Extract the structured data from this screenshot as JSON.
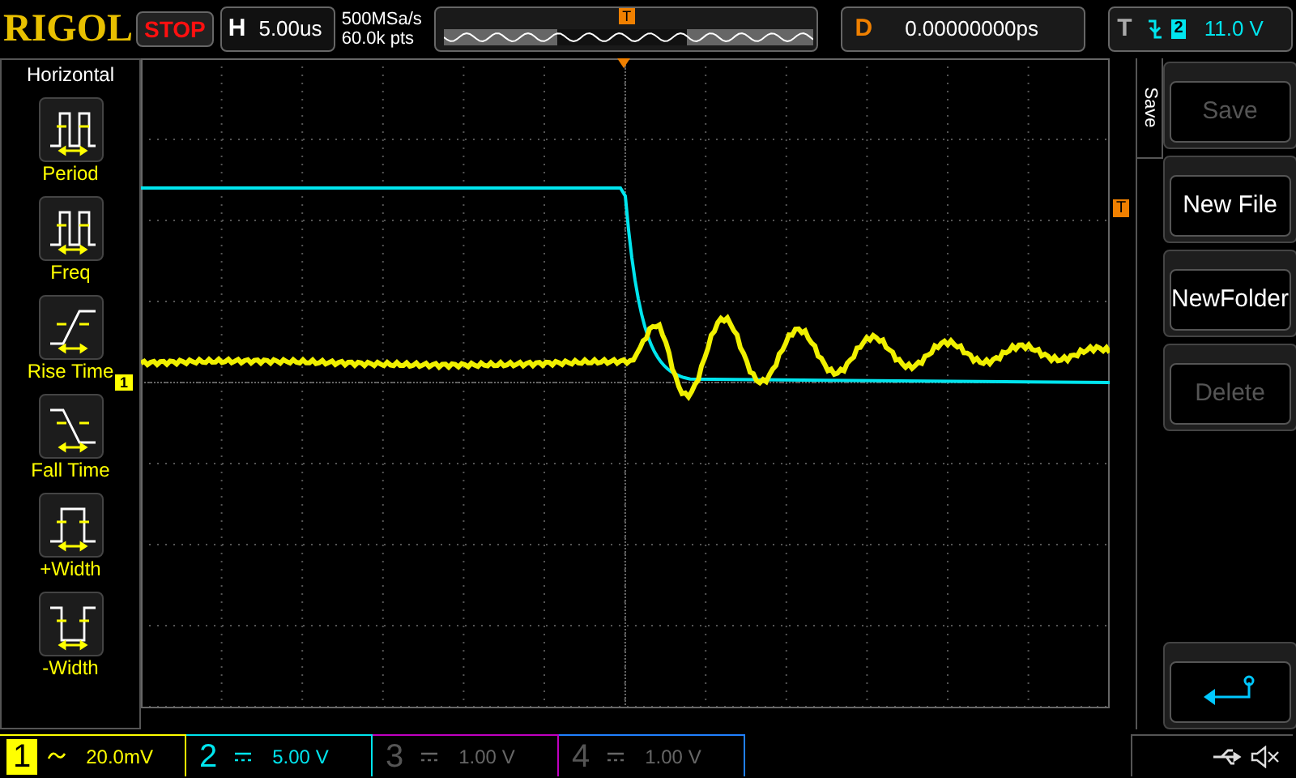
{
  "brand": "RIGOL",
  "run_state": "STOP",
  "horizontal": {
    "label": "H",
    "timebase": "5.00us"
  },
  "acquisition": {
    "sample_rate": "500MSa/s",
    "memory_depth": "60.0k pts"
  },
  "memory_bar": {
    "trigger_marker": "T"
  },
  "delay": {
    "label": "D",
    "value": "0.00000000ps"
  },
  "trigger": {
    "label": "T",
    "source": "2",
    "level": "11.0 V"
  },
  "left_menu": {
    "title": "Horizontal",
    "items": [
      {
        "label": "Period",
        "kind": "period"
      },
      {
        "label": "Freq",
        "kind": "freq"
      },
      {
        "label": "Rise Time",
        "kind": "rise"
      },
      {
        "label": "Fall Time",
        "kind": "fall"
      },
      {
        "label": "+Width",
        "kind": "pwidth"
      },
      {
        "label": "-Width",
        "kind": "nwidth"
      }
    ]
  },
  "screen": {
    "trigger_level_marker": "T",
    "channel_marker": "1"
  },
  "right_menu": {
    "tab": "Save",
    "buttons": [
      {
        "kind": "text",
        "label": "Save",
        "disabled": true
      },
      {
        "kind": "text",
        "label": "New File",
        "disabled": false
      },
      {
        "kind": "text",
        "label": "NewFolder",
        "disabled": false
      },
      {
        "kind": "text",
        "label": "Delete",
        "disabled": true
      },
      {
        "kind": "back"
      }
    ]
  },
  "channels": [
    {
      "number": "1",
      "kind": "ac",
      "scale": "20.0mV",
      "enabled": true,
      "selected": true,
      "color": "#ffff00"
    },
    {
      "number": "2",
      "kind": "dc",
      "scale": "5.00 V",
      "enabled": true,
      "selected": false,
      "color": "#00e5ee"
    },
    {
      "number": "3",
      "kind": "dc",
      "scale": "1.00 V",
      "enabled": false,
      "selected": false,
      "color": "#c000c0"
    },
    {
      "number": "4",
      "kind": "dc",
      "scale": "1.00 V",
      "enabled": false,
      "selected": false,
      "color": "#2080ff"
    }
  ]
}
